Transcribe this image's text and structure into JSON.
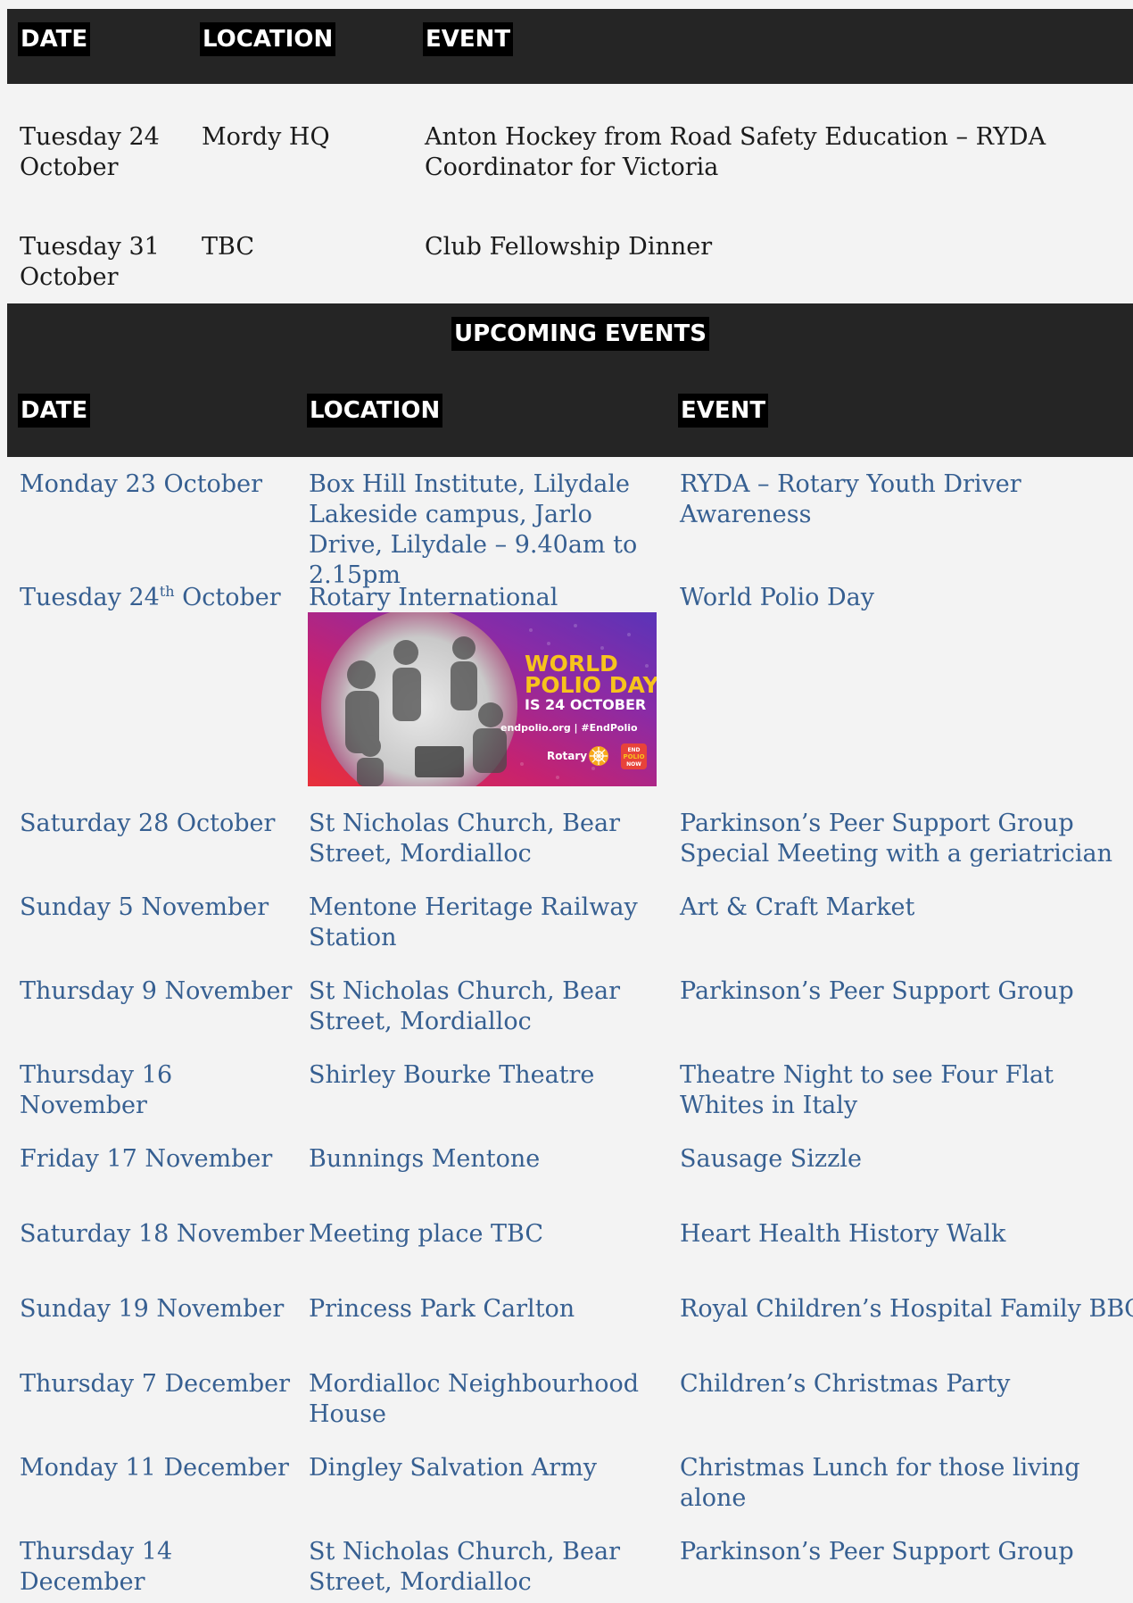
{
  "program": {
    "headers": {
      "date": "DATE",
      "location": "LOCATION",
      "event": "EVENT"
    },
    "rows": [
      {
        "date": "Tuesday 24 October",
        "location": "Mordy HQ",
        "event": "Anton Hockey from Road Safety Education – RYDA Coordinator for Victoria"
      },
      {
        "date": "Tuesday 31 October",
        "location": "TBC",
        "event": "Club Fellowship Dinner"
      }
    ]
  },
  "upcoming": {
    "title": "UPCOMING EVENTS",
    "headers": {
      "date": "DATE",
      "location": "LOCATION",
      "event": "EVENT"
    },
    "rows": [
      {
        "date": "Monday 23 October",
        "location": "Box Hill Institute, Lilydale Lakeside campus, Jarlo Drive, Lilydale – 9.40am to 2.15pm",
        "event": "RYDA – Rotary Youth Driver Awareness"
      },
      {
        "date_pre": "Tuesday 24",
        "date_sup": "th",
        "date_post": " October",
        "location": "Rotary International",
        "event": "World Polio Day"
      },
      {
        "date": "Saturday 28 October",
        "location": "St Nicholas Church, Bear Street, Mordialloc",
        "event": "Parkinson’s Peer Support Group Special Meeting with a geriatrician"
      },
      {
        "date": "Sunday 5 November",
        "location": "Mentone Heritage Railway Station",
        "event": "Art & Craft Market"
      },
      {
        "date": "Thursday 9 November",
        "location": "St Nicholas Church, Bear Street, Mordialloc",
        "event": "Parkinson’s Peer Support Group"
      },
      {
        "date": "Thursday 16 November",
        "location": "Shirley Bourke Theatre",
        "event": "Theatre Night to see Four Flat Whites in Italy"
      },
      {
        "date": "Friday 17 November",
        "location": "Bunnings Mentone",
        "event": "Sausage Sizzle"
      },
      {
        "date": "Saturday 18 November",
        "location": "Meeting place TBC",
        "event": "Heart Health History Walk"
      },
      {
        "date": "Sunday 19 November",
        "location": "Princess Park Carlton",
        "event": "Royal Children’s Hospital Family BBQ"
      },
      {
        "date": "Thursday 7 December",
        "location": "Mordialloc Neighbourhood House",
        "event": "Children’s Christmas Party"
      },
      {
        "date": "Monday 11 December",
        "location": "Dingley Salvation Army",
        "event": "Christmas Lunch for those living alone"
      },
      {
        "date": "Thursday 14 December",
        "location": "St Nicholas Church, Bear Street, Mordialloc",
        "event": "Parkinson’s Peer Support Group"
      }
    ]
  },
  "polio_banner": {
    "line1": "WORLD",
    "line2": "POLIO DAY",
    "line3": "IS 24 OCTOBER",
    "web": "endpolio.org | #EndPolio",
    "brand": "Rotary",
    "badge_line1": "END",
    "badge_line2": "POLIO",
    "badge_line3": "NOW",
    "colors": {
      "gradient_start": "#c7226f",
      "gradient_mid": "#8a2ba6",
      "gradient_end": "#5a34b8",
      "headline": "#f7c31c"
    }
  }
}
